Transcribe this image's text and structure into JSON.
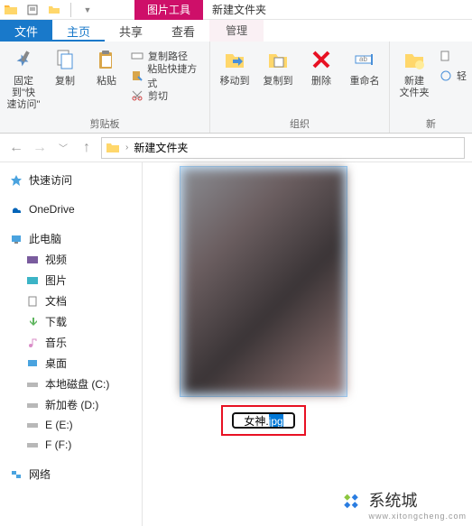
{
  "window": {
    "title": "新建文件夹",
    "contextual_tab": "图片工具"
  },
  "tabs": {
    "file": "文件",
    "home": "主页",
    "share": "共享",
    "view": "查看",
    "manage": "管理"
  },
  "ribbon": {
    "clipboard": {
      "group": "剪贴板",
      "pin": "固定到\"快\n速访问\"",
      "copy": "复制",
      "paste": "粘贴",
      "copy_path": "复制路径",
      "paste_shortcut": "粘贴快捷方式",
      "cut": "剪切"
    },
    "organize": {
      "group": "组织",
      "move_to": "移动到",
      "copy_to": "复制到",
      "delete": "删除",
      "rename": "重命名"
    },
    "new": {
      "group": "新",
      "new_folder": "新建\n文件夹",
      "easy": "轻"
    }
  },
  "address": {
    "root": "新建文件夹"
  },
  "nav": {
    "quick_access": "快速访问",
    "onedrive": "OneDrive",
    "this_pc": "此电脑",
    "videos": "视频",
    "pictures": "图片",
    "documents": "文档",
    "downloads": "下载",
    "music": "音乐",
    "desktop": "桌面",
    "local_c": "本地磁盘 (C:)",
    "local_d": "新加卷 (D:)",
    "local_e": "E (E:)",
    "local_f": "F (F:)",
    "network": "网络"
  },
  "file_rename": {
    "value": "女神.jpg"
  },
  "watermark": {
    "brand": "系统城",
    "url": "www.xitongcheng.com"
  }
}
